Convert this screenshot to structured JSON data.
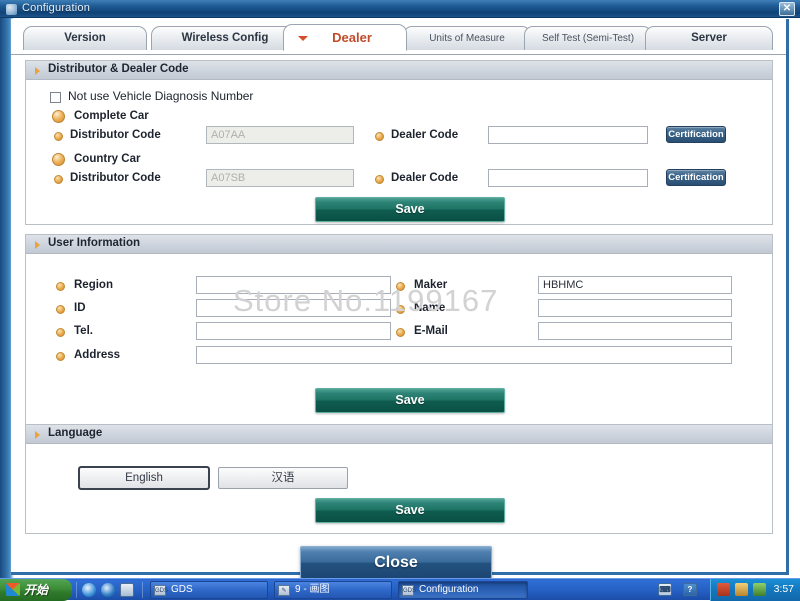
{
  "window": {
    "title": "Configuration",
    "close_label": "✕"
  },
  "tabs": [
    {
      "label": "Version",
      "active": false
    },
    {
      "label": "Wireless Config",
      "active": false
    },
    {
      "label": "Dealer",
      "active": true
    },
    {
      "label": "Units of Measure",
      "active": false
    },
    {
      "label": "Self Test (Semi-Test)",
      "active": false
    },
    {
      "label": "Server",
      "active": false
    }
  ],
  "distributor_panel": {
    "header": "Distributor & Dealer Code",
    "checkbox_label": "Not use Vehicle Diagnosis Number",
    "checkbox_checked": false,
    "groups": [
      {
        "title": "Complete Car",
        "distributor_label": "Distributor Code",
        "distributor_value": "A07AA",
        "distributor_disabled": true,
        "dealer_label": "Dealer Code",
        "dealer_value": "",
        "cert_label": "Certification"
      },
      {
        "title": "Country Car",
        "distributor_label": "Distributor Code",
        "distributor_value": "A07SB",
        "distributor_disabled": true,
        "dealer_label": "Dealer Code",
        "dealer_value": "",
        "cert_label": "Certification"
      }
    ],
    "save_label": "Save"
  },
  "user_panel": {
    "header": "User Information",
    "fields": {
      "region_label": "Region",
      "region_value": "",
      "id_label": "ID",
      "id_value": "",
      "tel_label": "Tel.",
      "tel_value": "",
      "address_label": "Address",
      "address_value": "",
      "maker_label": "Maker",
      "maker_value": "HBHMC",
      "name_label": "Name",
      "name_value": "",
      "email_label": "E-Mail",
      "email_value": ""
    },
    "save_label": "Save"
  },
  "language_panel": {
    "header": "Language",
    "options": [
      {
        "label": "English",
        "selected": true
      },
      {
        "label": "汉语",
        "selected": false
      }
    ],
    "save_label": "Save"
  },
  "close_button_label": "Close",
  "watermark": "Store No.1199167",
  "taskbar": {
    "start_label": "开始",
    "quicklaunch": [
      "ie-icon",
      "browser-icon",
      "gds-icon"
    ],
    "items": [
      {
        "label": "GDS",
        "icon": "gds",
        "active": false
      },
      {
        "label": "9 -  画图",
        "icon": "paint",
        "active": false
      },
      {
        "label": "Configuration",
        "icon": "gds",
        "active": true
      }
    ],
    "notify": [
      "keyboard-icon",
      "help-icon"
    ],
    "tray_icons": [
      "network-icon",
      "antivirus-icon",
      "volume-icon"
    ],
    "clock": "3:57"
  },
  "colors": {
    "title_blue": "#1f5b95",
    "accent_orange": "#eaa94a",
    "save_green": "#1d7263",
    "close_blue": "#3a6c9c",
    "active_tab_text": "#c14b2a"
  }
}
